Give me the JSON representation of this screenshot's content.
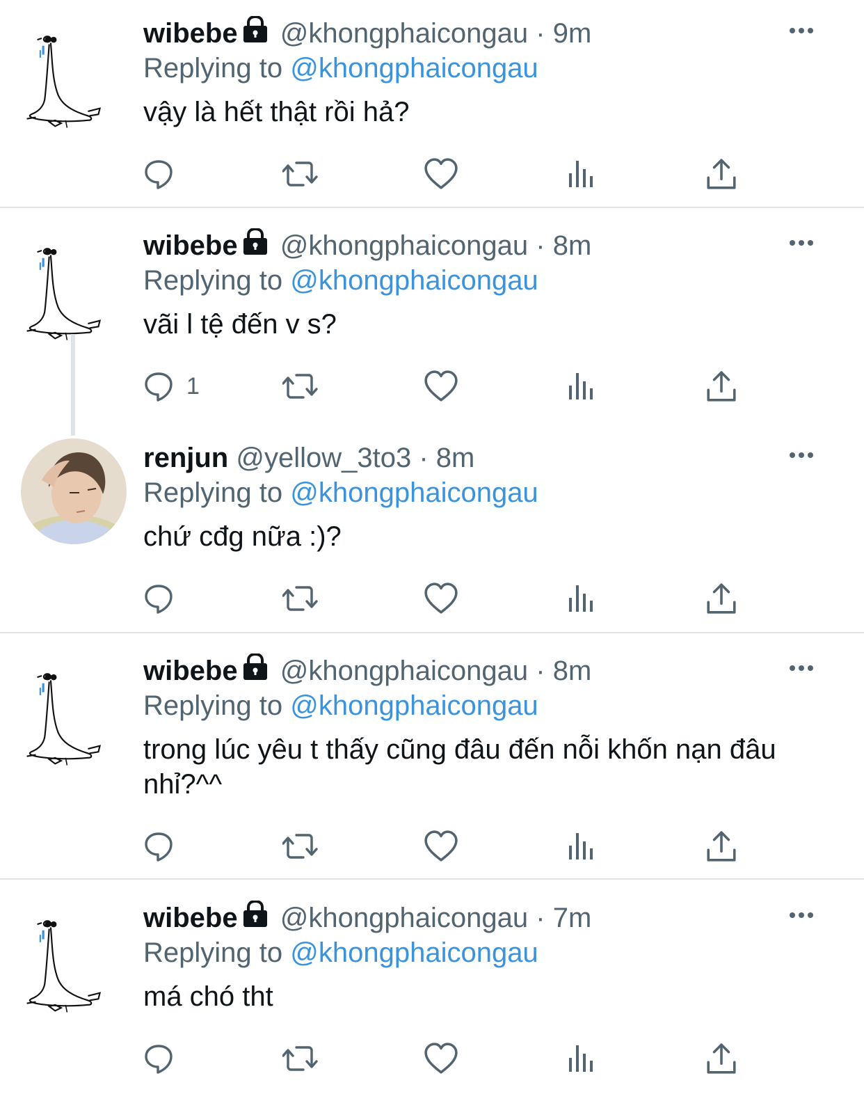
{
  "tweets": [
    {
      "name": "wibebe",
      "handle": "@khongphaicongau",
      "dot": "·",
      "time": "9m",
      "replying_prefix": "Replying to ",
      "replying_to": "@khongphaicongau",
      "text": "vậy là hết thật rồi hả?",
      "reply_count": "",
      "locked": true,
      "avatar": "goose-drawing"
    },
    {
      "name": "wibebe",
      "handle": "@khongphaicongau",
      "dot": "·",
      "time": "8m",
      "replying_prefix": "Replying to ",
      "replying_to": "@khongphaicongau",
      "text": "vãi l tệ đến v s?",
      "reply_count": "1",
      "locked": true,
      "avatar": "goose-drawing"
    },
    {
      "name": "renjun",
      "handle": "@yellow_3to3",
      "dot": "·",
      "time": "8m",
      "replying_prefix": "Replying to ",
      "replying_to": "@khongphaicongau",
      "text": "chứ cđg nữa :)?",
      "reply_count": "",
      "locked": false,
      "avatar": "photo"
    },
    {
      "name": "wibebe",
      "handle": "@khongphaicongau",
      "dot": "·",
      "time": "8m",
      "replying_prefix": "Replying to ",
      "replying_to": "@khongphaicongau",
      "text": "trong lúc yêu t thấy cũng đâu đến nỗi khốn nạn đâu nhỉ?^^",
      "reply_count": "",
      "locked": true,
      "avatar": "goose-drawing"
    },
    {
      "name": "wibebe",
      "handle": "@khongphaicongau",
      "dot": "·",
      "time": "7m",
      "replying_prefix": "Replying to ",
      "replying_to": "@khongphaicongau",
      "text": "má chó tht",
      "reply_count": "",
      "locked": true,
      "avatar": "goose-drawing"
    }
  ],
  "icons": {
    "reply": "reply-icon",
    "retweet": "retweet-icon",
    "like": "heart-icon",
    "analytics": "analytics-icon",
    "share": "share-icon",
    "more": "more-icon",
    "lock": "lock-icon"
  },
  "colors": {
    "text": "#0f1419",
    "secondary": "#536471",
    "mention": "#3a93dd",
    "divider": "#dfe3e6"
  }
}
